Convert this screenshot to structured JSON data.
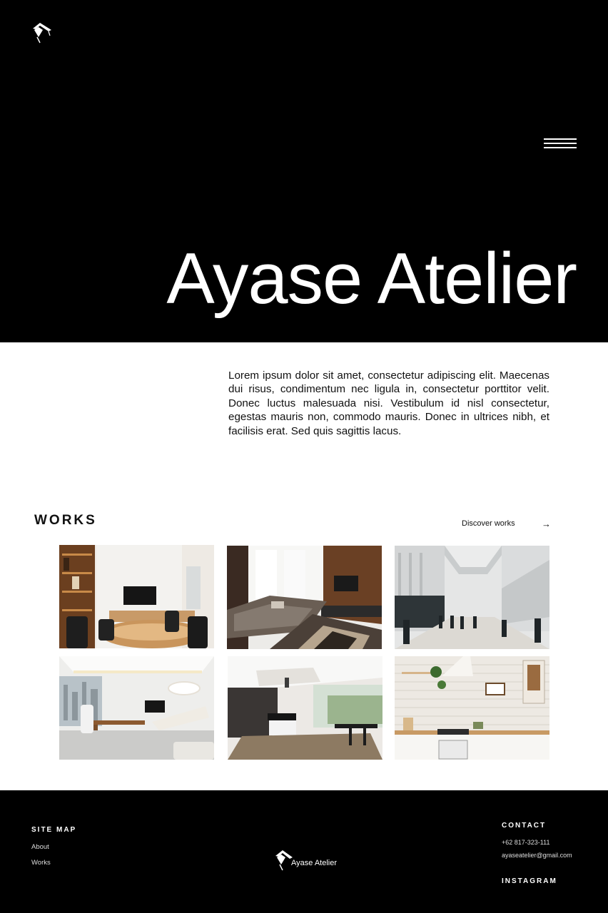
{
  "hero": {
    "title": "Ayase Atelier",
    "menu_icon": "hamburger-icon",
    "logo_icon": "brush-logo-icon"
  },
  "intro": {
    "text": "Lorem ipsum dolor sit amet, consectetur adipiscing elit. Maecenas dui risus, condimentum nec ligula in, consectetur porttitor velit. Donec luctus malesuada nisi. Vestibulum id nisl consectetur, egestas mauris non, commodo mauris. Donec in ultrices nibh, et facilisis erat. Sed quis sagittis lacus."
  },
  "works": {
    "title": "WORKS",
    "discover_label": "Discover works",
    "discover_arrow": "→",
    "items": [
      {
        "name": "boardroom"
      },
      {
        "name": "living-room"
      },
      {
        "name": "atrium-hall"
      },
      {
        "name": "executive-office"
      },
      {
        "name": "open-kitchen"
      },
      {
        "name": "white-kitchen"
      }
    ]
  },
  "footer": {
    "sitemap_title": "SITE MAP",
    "links": [
      "About",
      "Works"
    ],
    "brand_name": "Ayase Atelier",
    "contact_title": "CONTACT",
    "phone": "+62 817-323-111",
    "email": "ayaseatelier@gmail.com",
    "instagram_title": "INSTAGRAM"
  },
  "colors": {
    "dark": "#000000",
    "light": "#ffffff",
    "text": "#111111"
  }
}
